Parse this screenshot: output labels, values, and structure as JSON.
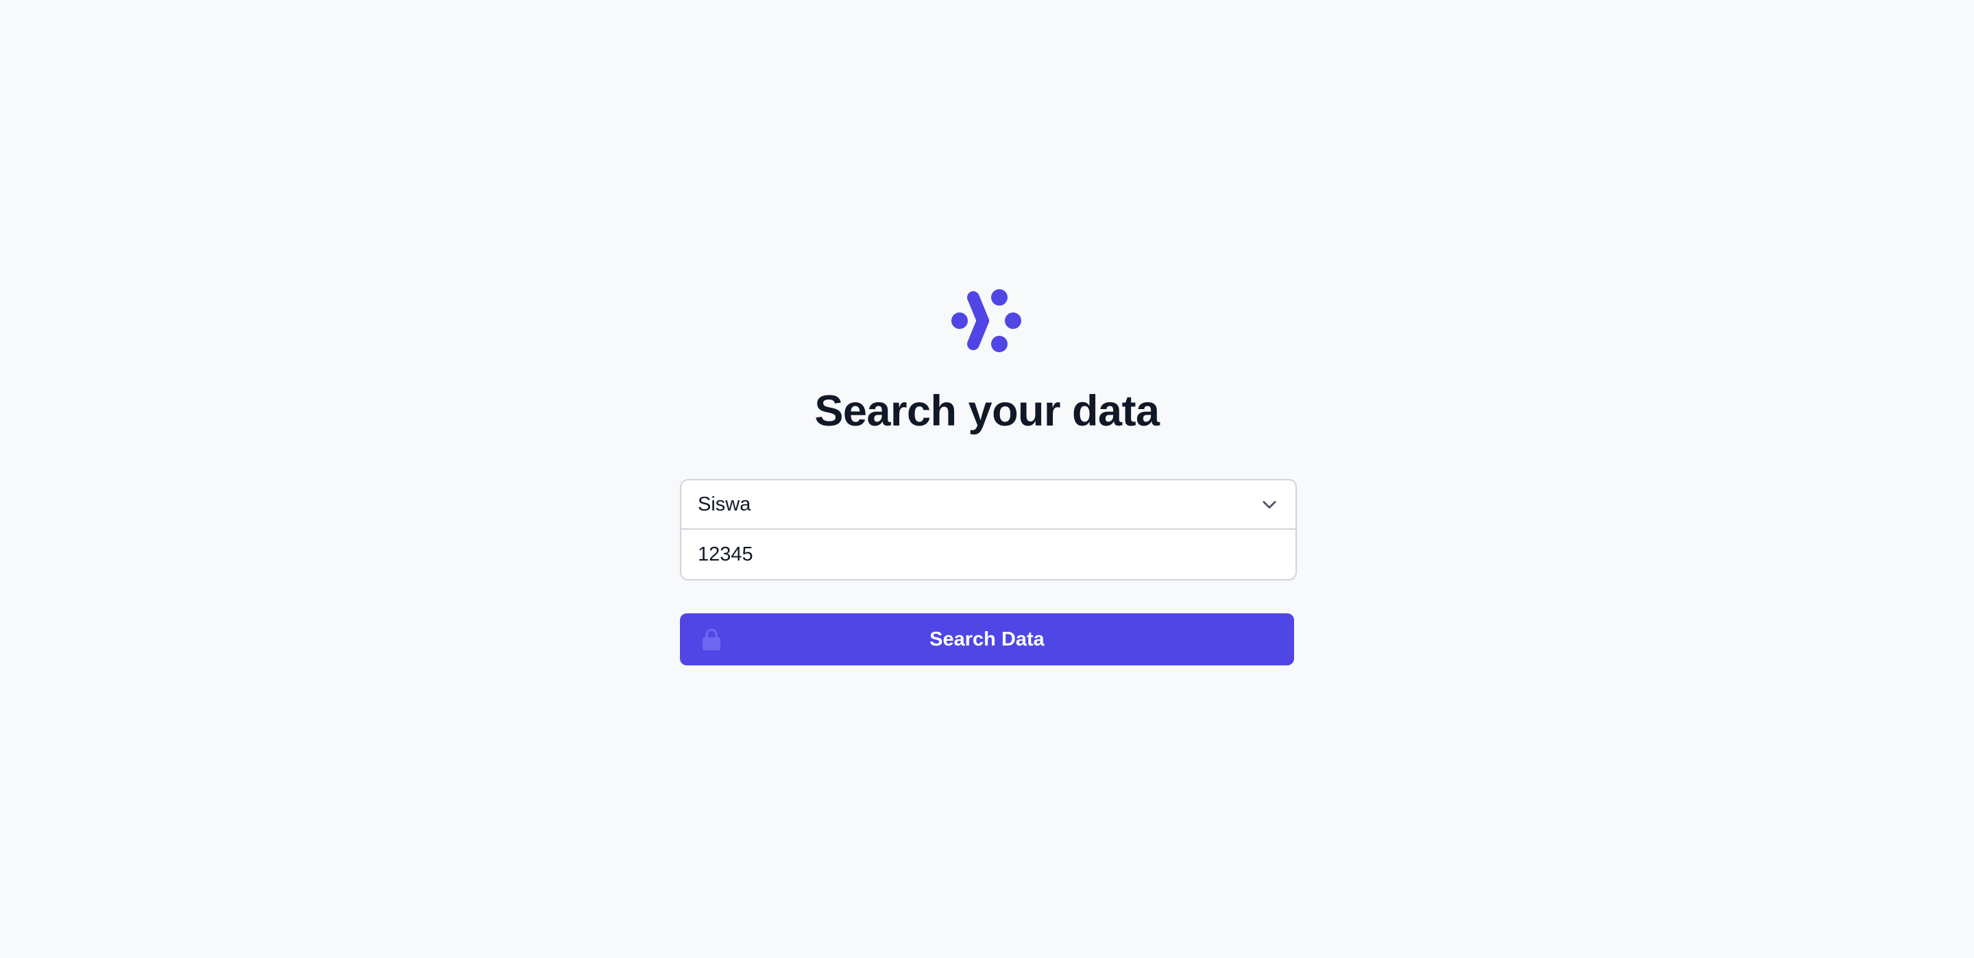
{
  "brand": {
    "logo_icon": "connected-dots-logo-icon",
    "accent_color": "#4f46e5"
  },
  "heading": {
    "title": "Search your data"
  },
  "form": {
    "select": {
      "selected_value": "Siswa",
      "icon": "chevron-down-icon"
    },
    "input": {
      "value": "12345"
    },
    "submit": {
      "label": "Search Data",
      "icon": "lock-icon"
    }
  }
}
